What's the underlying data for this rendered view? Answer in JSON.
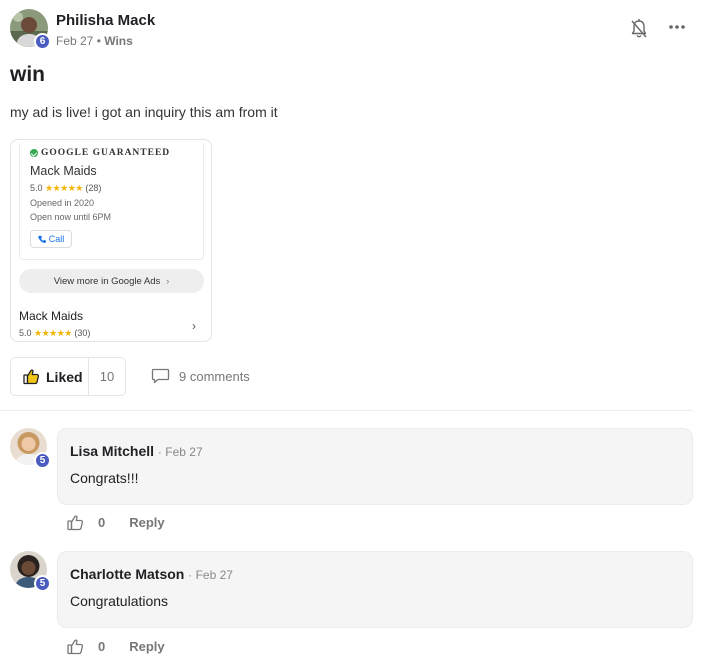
{
  "post": {
    "author": "Philisha Mack",
    "level": "6",
    "date": "Feb 27",
    "separator": "•",
    "category": "Wins",
    "title": "win",
    "body": "my ad is live! i got an inquiry this am from it"
  },
  "ad": {
    "guarantee_label": "GOOGLE GUARANTEED",
    "business_name": "Mack Maids",
    "rating": "5.0",
    "stars": "★★★★★",
    "reviews_top": "(28)",
    "opened": "Opened in 2020",
    "hours": "Open now until 6PM",
    "call_label": "Call",
    "view_more_label": "View more in Google Ads",
    "view_more_chevron": "›",
    "business_name_2": "Mack Maids",
    "reviews_bottom": "(30)",
    "row_chevron": "›"
  },
  "actions": {
    "liked_label": "Liked",
    "like_count": "10",
    "comments_label": "9 comments"
  },
  "comments": [
    {
      "author": "Lisa Mitchell",
      "level": "5",
      "date": "· Feb 27",
      "text": "Congrats!!!",
      "likes": "0",
      "reply_label": "Reply"
    },
    {
      "author": "Charlotte Matson",
      "level": "5",
      "date": "· Feb 27",
      "text": "Congratulations",
      "likes": "0",
      "reply_label": "Reply"
    }
  ],
  "colors": {
    "level_badge": "#4a5cc0",
    "star": "#f4b400",
    "call_link": "#1a73e8",
    "like_thumb": "#f0c419"
  }
}
